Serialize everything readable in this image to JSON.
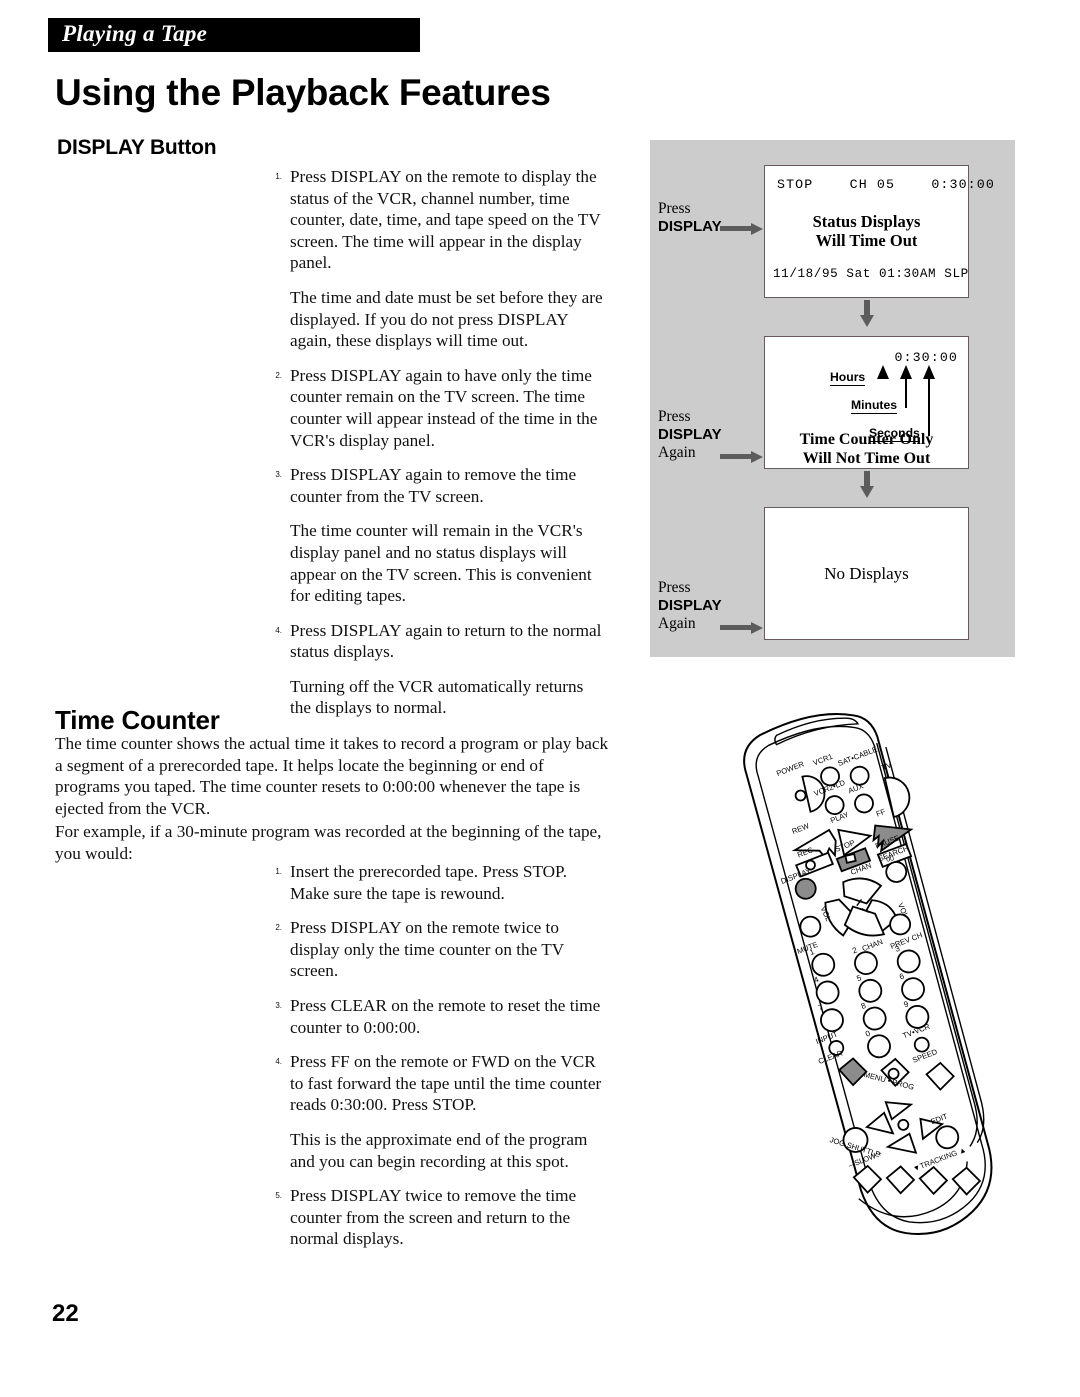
{
  "running_head": "Playing a Tape",
  "page_title": "Using the Playback Features",
  "page_number": "22",
  "sections": {
    "display_button": {
      "heading": "DISPLAY Button",
      "steps": [
        {
          "num": "1.",
          "text": "Press DISPLAY on the remote to display the status of the VCR, channel number, time counter, date, time, and tape speed on the TV screen.  The time will appear in the display panel.",
          "note": "The time and date must be set before they are displayed.  If you do not press DISPLAY again, these displays will time out."
        },
        {
          "num": "2.",
          "text": "Press DISPLAY again to have only the time counter remain on the TV screen.  The time counter will appear instead of the time in the VCR's display panel.",
          "note": ""
        },
        {
          "num": "3.",
          "text": "Press DISPLAY again to remove the time counter from the TV screen.",
          "note": "The time counter will remain in the VCR's display panel and no status displays will appear on the TV screen.  This is convenient for editing tapes."
        },
        {
          "num": "4.",
          "text": "Press DISPLAY again to return to the normal status displays.",
          "note": "Turning off the VCR automatically returns the displays to normal."
        }
      ]
    },
    "time_counter": {
      "heading": "Time Counter",
      "intro_paragraphs": [
        "The time counter shows the actual time it takes to record a program or play back a segment of a prerecorded tape.  It helps locate the beginning or end of programs you taped.  The time counter resets to 0:00:00 whenever the tape is ejected from the VCR.",
        "For example, if a 30-minute program was recorded at the beginning of the tape, you would:"
      ],
      "steps": [
        {
          "num": "1.",
          "text": "Insert the prerecorded tape.  Press STOP. Make sure the tape is rewound.",
          "note": ""
        },
        {
          "num": "2.",
          "text": "Press DISPLAY on the remote twice to display only the time counter on the TV screen.",
          "note": ""
        },
        {
          "num": "3.",
          "text": "Press CLEAR on the remote to reset the time counter to 0:00:00.",
          "note": ""
        },
        {
          "num": "4.",
          "text": "Press FF on the remote or FWD on the VCR to fast forward the tape until the time counter reads 0:30:00.  Press STOP.",
          "note": "This is the approximate end of the program and you can begin recording at this spot."
        },
        {
          "num": "5.",
          "text": "Press DISPLAY twice to remove the time counter from the screen and return to the normal displays.",
          "note": ""
        }
      ]
    }
  },
  "diagram": {
    "panel_color": "#cccccc",
    "press_captions": [
      {
        "press": "Press",
        "button": "DISPLAY",
        "again": ""
      },
      {
        "press": "Press",
        "button": "DISPLAY",
        "again": "Again"
      },
      {
        "press": "Press",
        "button": "DISPLAY",
        "again": "Again"
      }
    ],
    "screen_1": {
      "status_line": "STOP    CH 05    0:30:00",
      "message": "Status Displays\nWill Time Out",
      "date_line": "11/18/95 Sat 01:30AM SLP"
    },
    "screen_2": {
      "counter": "0:30:00",
      "callouts": [
        "Hours",
        "Minutes",
        "Seconds"
      ],
      "message": "Time Counter Only\nWill  Not Time Out"
    },
    "screen_3": {
      "message": "No Displays"
    }
  },
  "remote": {
    "buttons": [
      "POWER",
      "VCR1",
      "SAT•CABLE",
      "TV",
      "VCR2•LD",
      "AUX",
      "REW",
      "PLAY",
      "FF",
      "REC",
      "STOP",
      "PAUSE",
      "DISPLAY",
      "CHAN",
      "SEARCH",
      "VOL",
      "MUTE",
      "PREV CH",
      "1",
      "2",
      "3",
      "4",
      "5",
      "6",
      "7",
      "8",
      "9",
      "0",
      "INPUT",
      "TV•VCR",
      "CLEAR",
      "MENU • PROG",
      "SPEED",
      "JOG SHUTTLE",
      "EDIT",
      "SLOW",
      "TRACKING"
    ],
    "labels": {
      "power": "POWER",
      "vcr1": "VCR1",
      "sat_cable": "SAT•CABLE",
      "tv": "TV",
      "vcr2_ld": "VCR2•LD",
      "aux": "AUX",
      "rew": "REW",
      "play": "PLAY",
      "ff": "FF",
      "rec": "REC",
      "stop": "STOP",
      "pause": "PAUSE",
      "pause_digits": "00",
      "display": "DISPLAY",
      "chan_top": "CHAN",
      "chan_bottom": "CHAN",
      "search": "SEARCH",
      "vol_left": "VOL",
      "vol_right": "VOL",
      "mute": "MUTE",
      "prev_ch": "PREV CH",
      "n1": "1",
      "n2": "2",
      "n3": "3",
      "n4": "4",
      "n5": "5",
      "n6": "6",
      "n7": "7",
      "n8": "8",
      "n9": "9",
      "n0": "0",
      "input": "INPUT",
      "tv_vcr": "TV•VCR",
      "clear": "CLEAR",
      "menu_prog": "MENU • PROG",
      "speed": "SPEED",
      "jog_shuttle": "JOG SHUTTLE",
      "edit": "EDIT",
      "slow": "SLOW",
      "slow_minus": "–",
      "slow_plus": "+",
      "tracking": "TRACKING",
      "tracking_down": "▼",
      "tracking_up": "▲"
    }
  }
}
